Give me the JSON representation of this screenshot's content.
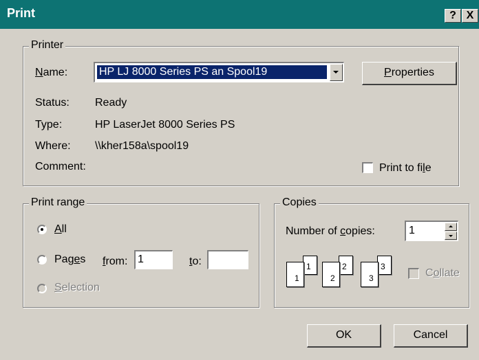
{
  "window": {
    "title": "Print",
    "help_glyph": "?",
    "close_glyph": "X"
  },
  "printer": {
    "group_label": "Printer",
    "name_label": "Name:",
    "name_value": "HP LJ 8000 Series PS an Spool19",
    "properties_label": "Properties",
    "status_label": "Status:",
    "status_value": "Ready",
    "type_label": "Type:",
    "type_value": "HP LaserJet 8000 Series PS",
    "where_label": "Where:",
    "where_value": "\\\\kher158a\\spool19",
    "comment_label": "Comment:",
    "print_to_file_label": "Print to file",
    "print_to_file_checked": false
  },
  "print_range": {
    "group_label": "Print range",
    "all_label": "All",
    "pages_label": "Pages",
    "from_label": "from:",
    "from_value": "1",
    "to_label": "to:",
    "to_value": "",
    "selection_label": "Selection",
    "selected": "All"
  },
  "copies": {
    "group_label": "Copies",
    "number_label": "Number of copies:",
    "number_value": "1",
    "collate_label": "Collate",
    "collate_checked": false,
    "page_labels": [
      "1",
      "1",
      "2",
      "2",
      "3",
      "3"
    ]
  },
  "buttons": {
    "ok_label": "OK",
    "cancel_label": "Cancel"
  },
  "icons": [
    "help-icon",
    "close-icon",
    "dropdown-arrow-icon",
    "spin-up-icon",
    "spin-down-icon",
    "collate-pages-icon"
  ]
}
